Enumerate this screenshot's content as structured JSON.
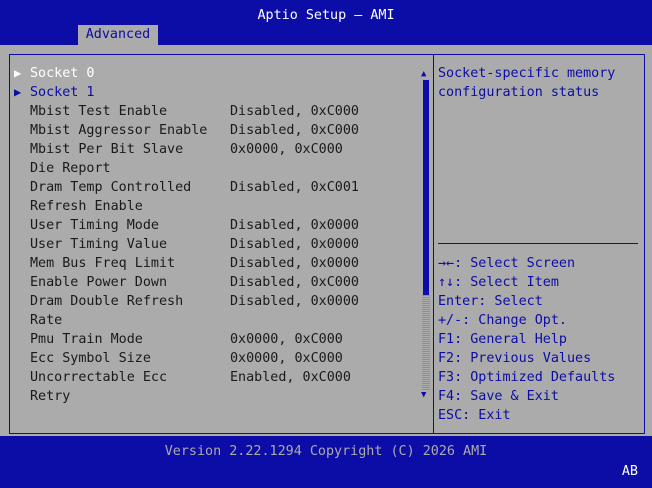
{
  "header": {
    "title": "Aptio Setup – AMI",
    "tab": "Advanced"
  },
  "menu": [
    {
      "label": "Socket 0",
      "value": "",
      "submenu": true
    },
    {
      "label": "Socket 1",
      "value": "",
      "submenu": true
    },
    {
      "label": "Mbist Test Enable",
      "value": "Disabled, 0xC000"
    },
    {
      "label": "Mbist Aggressor Enable",
      "value": "Disabled, 0xC000"
    },
    {
      "label": "Mbist Per Bit Slave",
      "value": "0x0000, 0xC000"
    },
    {
      "label": "Die Report",
      "value": ""
    },
    {
      "label": "Dram Temp Controlled",
      "value": "Disabled, 0xC001"
    },
    {
      "label": "Refresh Enable",
      "value": ""
    },
    {
      "label": "User Timing Mode",
      "value": "Disabled, 0x0000"
    },
    {
      "label": "User Timing Value",
      "value": "Disabled, 0x0000"
    },
    {
      "label": "Mem Bus Freq Limit",
      "value": "Disabled, 0x0000"
    },
    {
      "label": "Enable Power Down",
      "value": "Disabled, 0xC000"
    },
    {
      "label": "Dram Double Refresh",
      "value": "Disabled, 0x0000"
    },
    {
      "label": "Rate",
      "value": ""
    },
    {
      "label": "Pmu Train Mode",
      "value": "0x0000, 0xC000"
    },
    {
      "label": "Ecc Symbol Size",
      "value": "0x0000, 0xC000"
    },
    {
      "label": "Uncorrectable Ecc",
      "value": "Enabled, 0xC000"
    },
    {
      "label": "Retry",
      "value": ""
    }
  ],
  "help": {
    "line1": "Socket-specific memory",
    "line2": "configuration status"
  },
  "keys": [
    "→←: Select Screen",
    "↑↓: Select Item",
    "Enter: Select",
    "+/-: Change Opt.",
    "F1: General Help",
    "F2: Previous Values",
    "F3: Optimized Defaults",
    "F4: Save & Exit",
    "ESC: Exit"
  ],
  "footer": {
    "version": "Version 2.22.1294 Copyright (C) 2026 AMI",
    "lang": "AB"
  },
  "colors": {
    "blue": "#0c0ca6",
    "gray": "#ababab",
    "white": "#ffffff"
  },
  "icons": {
    "submenu": "triangle-right-icon",
    "scroll_up": "triangle-up-icon",
    "scroll_down": "triangle-down-icon"
  }
}
